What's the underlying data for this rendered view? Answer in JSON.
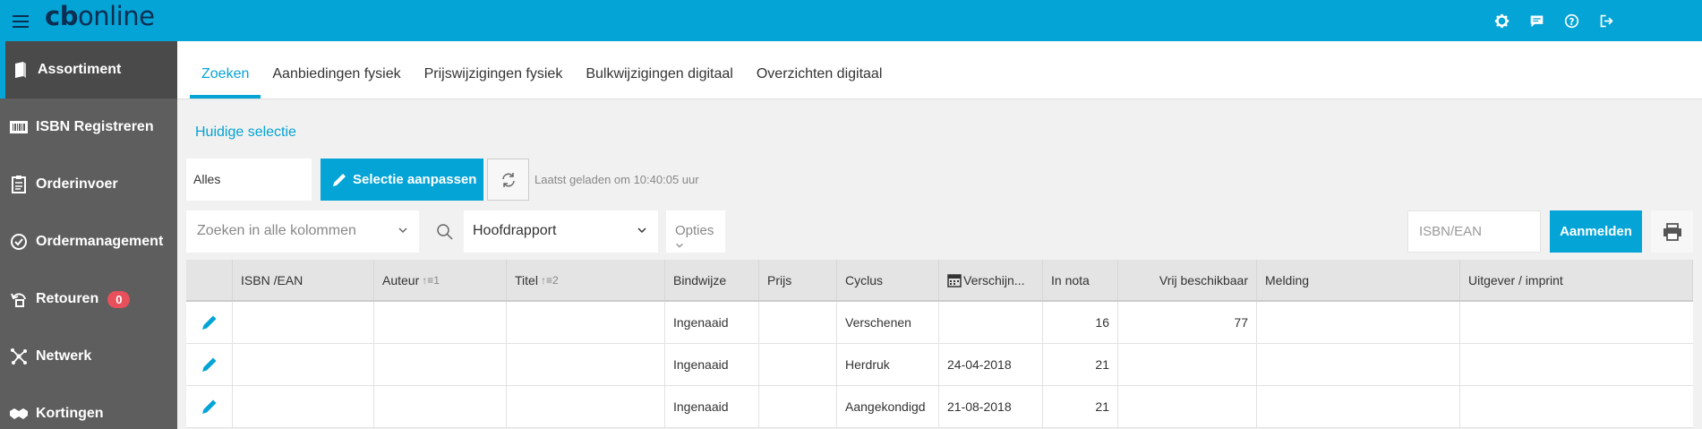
{
  "app": {
    "logo_cb": "cb",
    "logo_online": "online"
  },
  "topbar": {
    "icons": [
      "settings-icon",
      "chat-icon",
      "help-icon",
      "logout-icon"
    ]
  },
  "sidebar": {
    "items": [
      {
        "label": "Assortiment",
        "icon": "book-icon",
        "active": true
      },
      {
        "label": "ISBN Registreren",
        "icon": "barcode-icon"
      },
      {
        "label": "Orderinvoer",
        "icon": "clipboard-icon"
      },
      {
        "label": "Ordermanagement",
        "icon": "check-circle-icon"
      },
      {
        "label": "Retouren",
        "icon": "return-icon",
        "badge": "0"
      },
      {
        "label": "Netwerk",
        "icon": "network-icon"
      },
      {
        "label": "Kortingen",
        "icon": "handshake-icon"
      }
    ]
  },
  "tabs": [
    {
      "label": "Zoeken",
      "active": true
    },
    {
      "label": "Aanbiedingen fysiek"
    },
    {
      "label": "Prijswijzigingen fysiek"
    },
    {
      "label": "Bulkwijzigingen digitaal"
    },
    {
      "label": "Overzichten digitaal"
    }
  ],
  "selection": {
    "link": "Huidige selectie",
    "scope": "Alles",
    "edit_button": "Selectie aanpassen",
    "last_loaded": "Laatst geladen om 10:40:05 uur"
  },
  "toolbar": {
    "search_placeholder": "Zoeken in alle kolommen",
    "report": "Hoofdrapport",
    "options": "Opties",
    "isbn_placeholder": "ISBN/EAN",
    "register_button": "Aanmelden"
  },
  "table": {
    "headers": {
      "isbn": "ISBN /EAN",
      "auteur": "Auteur",
      "auteur_sort": "↑≡1",
      "titel": "Titel",
      "titel_sort": "↑≡2",
      "bindwijze": "Bindwijze",
      "prijs": "Prijs",
      "cyclus": "Cyclus",
      "verschijn": "Verschijn...",
      "in_nota": "In nota",
      "vrij": "Vrij beschikbaar",
      "melding": "Melding",
      "uitgever": "Uitgever / imprint"
    },
    "rows": [
      {
        "isbn": "",
        "auteur": "",
        "titel": "",
        "bindwijze": "Ingenaaid",
        "prijs": "",
        "cyclus": "Verschenen",
        "verschijn": "",
        "in_nota": "16",
        "vrij": "77",
        "melding": "",
        "uitgever": ""
      },
      {
        "isbn": "",
        "auteur": "",
        "titel": "",
        "bindwijze": "Ingenaaid",
        "prijs": "",
        "cyclus": "Herdruk",
        "verschijn": "24-04-2018",
        "in_nota": "21",
        "vrij": "",
        "melding": "",
        "uitgever": ""
      },
      {
        "isbn": "",
        "auteur": "",
        "titel": "",
        "bindwijze": "Ingenaaid",
        "prijs": "",
        "cyclus": "Aangekondigd",
        "verschijn": "21-08-2018",
        "in_nota": "21",
        "vrij": "",
        "melding": "",
        "uitgever": ""
      }
    ]
  },
  "colors": {
    "accent": "#05a4d6",
    "sidebar": "#5e5e5e",
    "badge": "#e8505b"
  }
}
